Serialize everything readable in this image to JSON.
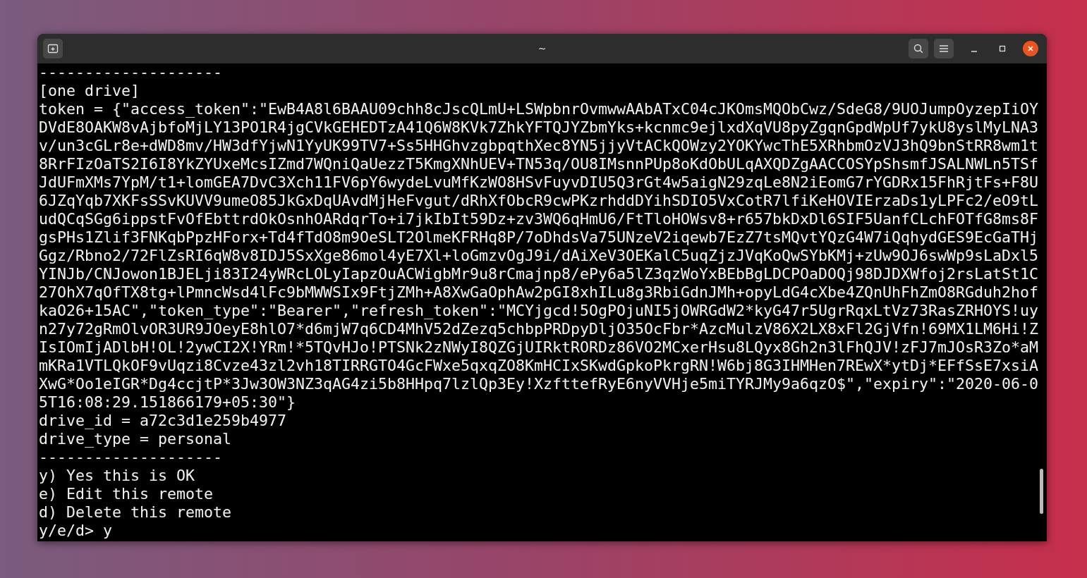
{
  "window": {
    "title": "~"
  },
  "terminal": {
    "lines": [
      "--------------------",
      "[one drive]",
      "token = {\"access_token\":\"EwB4A8l6BAAU09chh8cJscQLmU+LSWpbnrOvmwwAAbATxC04cJKOmsMQObCwz/SdeG8/9UOJumpOyzepIiOY",
      "DVdE8OAKW8vAjbfoMjLY13PO1R4jgCVkGEHEDTzA41Q6W8KVk7ZhkYFTQJYZbmYks+kcnmc9ejlxdXqVU8pyZgqnGpdWpUf7ykU8yslMyLNA3",
      "v/un3cGLr8e+dWD8mv/HW3dfYjwN1YyUK99TV7+Ss5HHGhvzgbpqthXec8YN5jjyVtACkQOWzy2YOKYwcThE5XRhbmOzVJ3hQ9bnStRR8wm1t",
      "8RrFIzOaTS2I6I8YkZYUxeMcsIZmd7WQniQaUezzT5KmgXNhUEV+TN53q/OU8IMsnnPUp8oKdObULqAXQDZgAACCOSYpShsmfJSALNWLn5TSf",
      "JdUFmXMs7YpM/t1+lomGEA7DvC3Xch11FV6pY6wydeLvuMfKzWO8HSvFuyvDIU5Q3rGt4w5aigN29zqLe8N2iEomG7rYGDRx15FhRjtFs+F8U",
      "6JZqYqb7XKFsSSvKUVV9umeO85JkGxDqUAvdMjHeFvgut/dRhXfObcR9cwPKzrhddDYihSDIO5VxCotR7lfiKeHOVIErzaDs1yLPFc2/eO9tL",
      "udQCqSGg6ippstFvOfEbttrdOkOsnhOARdqrTo+i7jkIbIt59Dz+zv3WQ6qHmU6/FtTloHOWsv8+r657bkDxDl6SIF5UanfCLchFOTfG8ms8F",
      "gsPHs1Zlif3FNKqbPpzHForx+Td4fTdO8m9OeSLT2OlmeKFRHq8P/7oDhdsVa75UNzeV2iqewb7EzZ7tsMQvtYQzG4W7iQqhydGES9EcGaTHj",
      "Ggz/Rbno2/72FlZsRI6qW8v8IDJ5SxXge86mol4yE7Xl+loGmzvOgJ9i/dAiXeV3OEKalC5uqZjzJVqKoQwSYbKMj+zUw9OJ6swWp9sLaDxl5",
      "YINJb/CNJowon1BJELji83I24yWRcLOLyIapzOuACWigbMr9u8rCmajnp8/ePy6a5lZ3qzWoYxBEbBgLDCPOaDOQj98DJDXWfoj2rsLatSt1C",
      "27OhX7qOfTX8tg+lPmncWsd4lFc9bMWWSIx9FtjZMh+A8XwGaOphAw2pGI8xhILu8g3RbiGdnJMh+opyLdG4cXbe4ZQnUhFhZmO8RGduh2hof",
      "kaO26+15AC\",\"token_type\":\"Bearer\",\"refresh_token\":\"MCYjgcd!5OgPOjuNI5jOWRGdW2*kyG47r5UgrRqxLtVz73RasZRHOYS!uy",
      "n27y72gRmOlvOR3UR9JOeyE8hlO7*d6mjW7q6CD4MhV52dZezq5chbpPRDpyDljO35OcFbr*AzcMulzV86X2LX8xFl2GjVfn!69MX1LM6Hi!Z",
      "IsIOmIjADlbH!OL!2ywCI2X!YRm!*5TQvHJo!PTSNk2zNWyI8QZGjUIRktRORDz86VO2MCxerHsu8LQyx8Gh2n3lFhQJV!zFJ7mJOsR3Zo*aM",
      "mKRa1VTLQkOF9vUqzi8Cvze43zl2vh18TIRRGTO4GcFWxe5qxqZO8KmHCIxSKwdGpkoPkrgRN!W6bj8G3IHMHen7REwX*ytDj*EFfSsE7xsiA",
      "XwG*Oo1eIGR*Dg4ccjtP*3Jw3OW3NZ3qAG4zi5b8HHpq7lzlQp3Ey!XzfttefRyE6nyVVHje5miTYRJMy9a6qzO$\",\"expiry\":\"2020-06-0",
      "5T16:08:29.151866179+05:30\"}",
      "drive_id = a72c3d1e259b4977",
      "drive_type = personal",
      "--------------------",
      "y) Yes this is OK",
      "e) Edit this remote",
      "d) Delete this remote",
      "y/e/d> y"
    ]
  }
}
